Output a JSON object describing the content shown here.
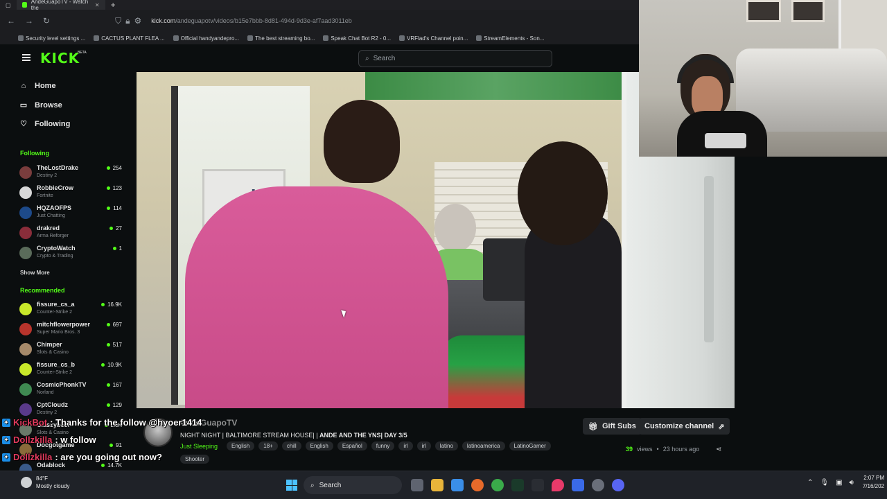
{
  "browser": {
    "tab_title": "AndeGuapoTV - Watch the",
    "url_domain": "kick.com",
    "url_path": "/andeguapotv/videos/b15e7bbb-8d81-494d-9d3e-af7aad3011eb",
    "bookmarks": [
      "Security level settings ...",
      "CACTUS PLANT FLEA ...",
      "Official handyandepro...",
      "The best streaming bo...",
      "Speak Chat Bot R2 - 0...",
      "VRFlad's Channel poin...",
      "StreamElements - Son..."
    ]
  },
  "header": {
    "logo": "KICK",
    "beta": "BETA",
    "search_placeholder": "Search"
  },
  "nav": {
    "home": "Home",
    "browse": "Browse",
    "following": "Following"
  },
  "following": {
    "heading": "Following",
    "channels": [
      {
        "name": "TheLostDrake",
        "game": "Destiny 2",
        "viewers": "254"
      },
      {
        "name": "RobbieCrow",
        "game": "Fortnite",
        "viewers": "123"
      },
      {
        "name": "HQZAOFPS",
        "game": "Just Chatting",
        "viewers": "114"
      },
      {
        "name": "drakred",
        "game": "Arma Reforger",
        "viewers": "27"
      },
      {
        "name": "CryptoWatch",
        "game": "Crypto & Trading",
        "viewers": "1"
      }
    ],
    "show_more": "Show More"
  },
  "recommended": {
    "heading": "Recommended",
    "channels": [
      {
        "name": "fissure_cs_a",
        "game": "Counter-Strike 2",
        "viewers": "16.9K"
      },
      {
        "name": "mitchflowerpower",
        "game": "Super Mario Bros. 3",
        "viewers": "697"
      },
      {
        "name": "Chimper",
        "game": "Slots & Casino",
        "viewers": "517"
      },
      {
        "name": "fissure_cs_b",
        "game": "Counter-Strike 2",
        "viewers": "10.9K"
      },
      {
        "name": "CosmicPhonkTV",
        "game": "Norland",
        "viewers": "167"
      },
      {
        "name": "CptCloudz",
        "game": "Destiny 2",
        "viewers": "129"
      },
      {
        "name": "Classybeef",
        "game": "Slots & Casino",
        "viewers": "2.9K"
      },
      {
        "name": "Docgotgame",
        "game": "",
        "viewers": "91"
      },
      {
        "name": "Odablock",
        "game": "",
        "viewers": "14.7K"
      }
    ]
  },
  "stream": {
    "streamer": "AndeGuapoTV",
    "title_prefix": "NIGHT NIGHT | BALTIMORE STREAM HOUSE| | ",
    "title_bold": "ANDE AND THE YNS| DAY 3/5",
    "category": "Just Sleeping",
    "tags": [
      "English",
      "18+",
      "chill",
      "English",
      "Español",
      "funny",
      "irl",
      "irl",
      "latino",
      "latinoamerica",
      "LatinoGamer"
    ],
    "tag_row2": "Shooter",
    "gift_label": "Gift Subs",
    "customize_label": "Customize channel",
    "views_num": "39",
    "views_label": "views",
    "time_ago": "23 hours ago"
  },
  "chat": [
    {
      "user": "KickBot",
      "message": ": Thanks for the follow @hyoer1414"
    },
    {
      "user": "Dollzkilla",
      "message": ": w follow"
    },
    {
      "user": "Dollzkilla",
      "message": ": are you going out now?"
    }
  ],
  "taskbar": {
    "temperature": "84°F",
    "weather": "Mostly cloudy",
    "search": "Search",
    "time": "2:07 PM",
    "date": "7/16/202"
  },
  "colors": {
    "kick_green": "#53fc18",
    "background": "#0b0e0f",
    "chat_user": "#e33b5f"
  }
}
